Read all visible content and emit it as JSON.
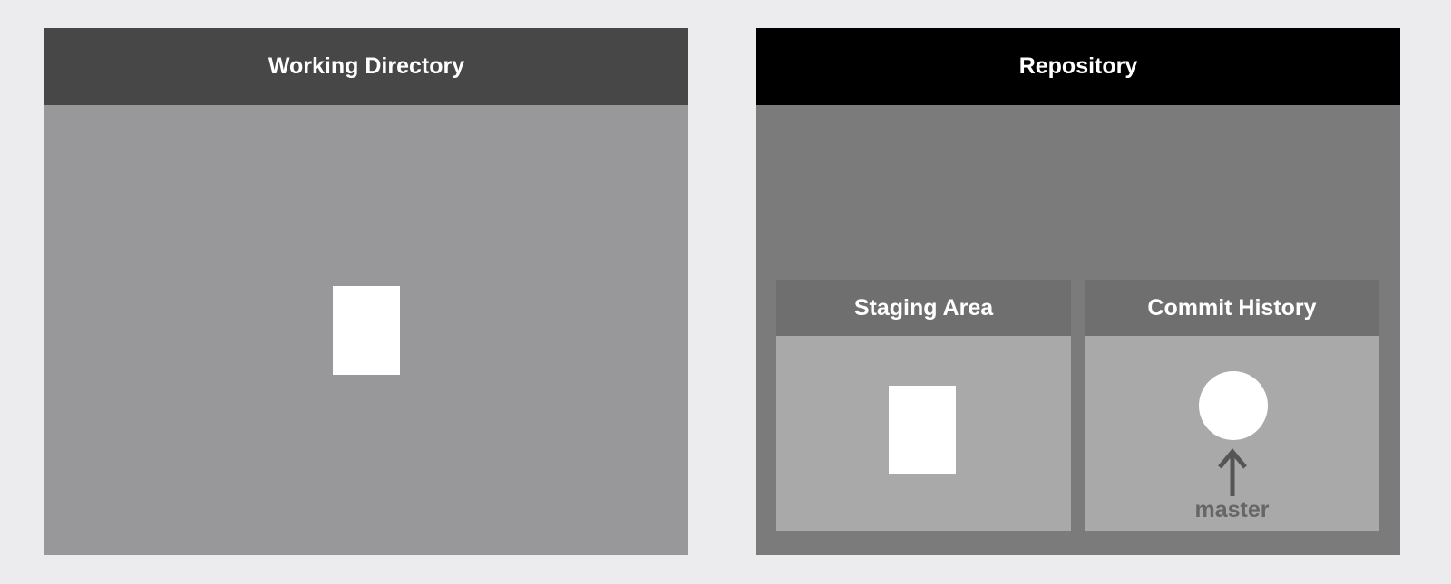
{
  "working_directory": {
    "title": "Working Directory"
  },
  "repository": {
    "title": "Repository",
    "staging_area": {
      "title": "Staging Area"
    },
    "commit_history": {
      "title": "Commit History",
      "branch": "master"
    }
  },
  "colors": {
    "page_background": "#ececee",
    "working_directory_header": "#474747",
    "working_directory_body": "#98989a",
    "repository_header": "#000000",
    "repository_body": "#7b7b7b",
    "sub_header": "#6f6f6f",
    "sub_body": "#a9a9a9",
    "item": "#ffffff",
    "branch_label": "#666666"
  }
}
